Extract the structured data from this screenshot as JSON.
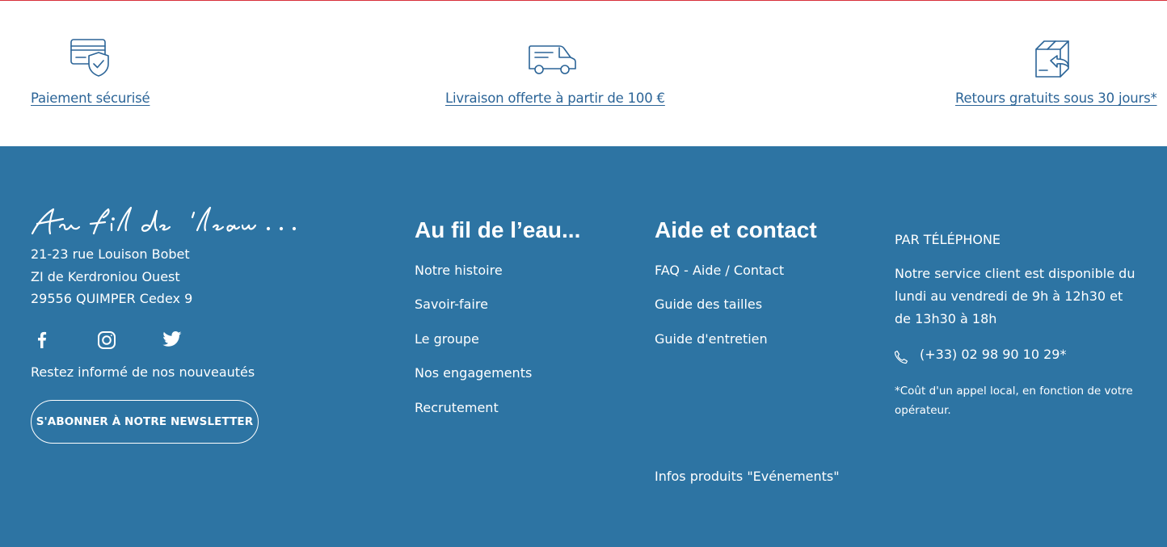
{
  "reassurance": {
    "items": [
      {
        "label": "Paiement sécurisé",
        "icon": "secure-card-icon"
      },
      {
        "label": "Livraison offerte à partir de 100 €",
        "icon": "delivery-van-icon"
      },
      {
        "label": "Retours gratuits sous 30 jours*",
        "icon": "return-box-icon"
      }
    ]
  },
  "footer": {
    "logo_text": "Au fil de l'eau...",
    "address": {
      "line1": "21-23 rue Louison Bobet",
      "line2": "ZI de Kerdroniou Ouest",
      "line3": "29556 QUIMPER Cedex 9"
    },
    "social": [
      "facebook-icon",
      "instagram-icon",
      "twitter-icon"
    ],
    "newsletter_text": "Restez informé de nos nouveautés",
    "newsletter_button": "S'ABONNER À NOTRE NEWSLETTER",
    "brand_col": {
      "title": "Au fil de l’eau...",
      "links": [
        "Notre histoire",
        "Savoir-faire",
        "Le groupe",
        "Nos engagements",
        "Recrutement"
      ]
    },
    "help_col": {
      "title": "Aide et contact",
      "links": [
        "FAQ - Aide / Contact",
        "Guide des tailles",
        "Guide d'entretien",
        "Infos produits \"Evénements\""
      ]
    },
    "phone": {
      "heading": "PAR TÉLÉPHONE",
      "description": "Notre service client est disponible du lundi au vendredi de 9h à 12h30 et de 13h30 à 18h",
      "number": "(+33) 02 98 90 10 29*",
      "note": "*Coût d'un appel local, en fonction de votre opérateur."
    }
  },
  "colors": {
    "footer_bg": "#2d74a3",
    "link_blue": "#2b6497",
    "accent_red": "#d8303a"
  }
}
